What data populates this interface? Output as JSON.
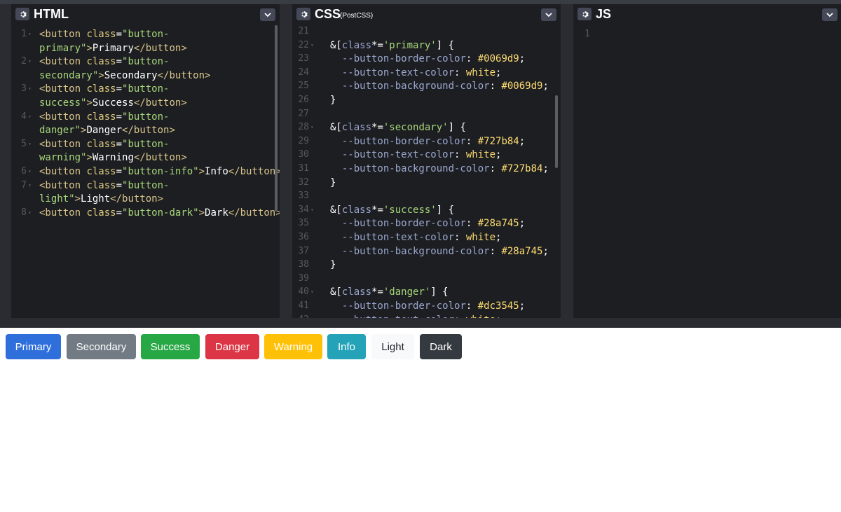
{
  "html_panel": {
    "title": "HTML",
    "gear": "gear-icon",
    "menu": "chevron-down-icon",
    "lines": [
      {
        "n": "1",
        "parts": [
          [
            "tag",
            "<button "
          ],
          [
            "attr",
            "class"
          ],
          [
            "white",
            "="
          ],
          [
            "str",
            "\"button-"
          ]
        ]
      },
      {
        "n": "",
        "parts": [
          [
            "str",
            "primary\""
          ],
          [
            "tag",
            ">"
          ],
          [
            "white",
            "Primary"
          ],
          [
            "tag",
            "</button>"
          ]
        ]
      },
      {
        "n": "2",
        "parts": [
          [
            "tag",
            "<button "
          ],
          [
            "attr",
            "class"
          ],
          [
            "white",
            "="
          ],
          [
            "str",
            "\"button-"
          ]
        ]
      },
      {
        "n": "",
        "parts": [
          [
            "str",
            "secondary\""
          ],
          [
            "tag",
            ">"
          ],
          [
            "white",
            "Secondary"
          ],
          [
            "tag",
            "</button>"
          ]
        ]
      },
      {
        "n": "3",
        "parts": [
          [
            "tag",
            "<button "
          ],
          [
            "attr",
            "class"
          ],
          [
            "white",
            "="
          ],
          [
            "str",
            "\"button-"
          ]
        ]
      },
      {
        "n": "",
        "parts": [
          [
            "str",
            "success\""
          ],
          [
            "tag",
            ">"
          ],
          [
            "white",
            "Success"
          ],
          [
            "tag",
            "</button>"
          ]
        ]
      },
      {
        "n": "4",
        "parts": [
          [
            "tag",
            "<button "
          ],
          [
            "attr",
            "class"
          ],
          [
            "white",
            "="
          ],
          [
            "str",
            "\"button-"
          ]
        ]
      },
      {
        "n": "",
        "parts": [
          [
            "str",
            "danger\""
          ],
          [
            "tag",
            ">"
          ],
          [
            "white",
            "Danger"
          ],
          [
            "tag",
            "</button>"
          ]
        ]
      },
      {
        "n": "5",
        "parts": [
          [
            "tag",
            "<button "
          ],
          [
            "attr",
            "class"
          ],
          [
            "white",
            "="
          ],
          [
            "str",
            "\"button-"
          ]
        ]
      },
      {
        "n": "",
        "parts": [
          [
            "str",
            "warning\""
          ],
          [
            "tag",
            ">"
          ],
          [
            "white",
            "Warning"
          ],
          [
            "tag",
            "</button>"
          ]
        ]
      },
      {
        "n": "6",
        "parts": [
          [
            "tag",
            "<button "
          ],
          [
            "attr",
            "class"
          ],
          [
            "white",
            "="
          ],
          [
            "str",
            "\"button-info\""
          ],
          [
            "tag",
            ">"
          ],
          [
            "white",
            "Info"
          ],
          [
            "tag",
            "</button>"
          ]
        ]
      },
      {
        "n": "7",
        "parts": [
          [
            "tag",
            "<button "
          ],
          [
            "attr",
            "class"
          ],
          [
            "white",
            "="
          ],
          [
            "str",
            "\"button-"
          ]
        ]
      },
      {
        "n": "",
        "parts": [
          [
            "str",
            "light\""
          ],
          [
            "tag",
            ">"
          ],
          [
            "white",
            "Light"
          ],
          [
            "tag",
            "</button>"
          ]
        ]
      },
      {
        "n": "8",
        "parts": [
          [
            "tag",
            "<button "
          ],
          [
            "attr",
            "class"
          ],
          [
            "white",
            "="
          ],
          [
            "str",
            "\"button-dark\""
          ],
          [
            "tag",
            ">"
          ],
          [
            "white",
            "Dark"
          ],
          [
            "tag",
            "</button>"
          ]
        ]
      }
    ]
  },
  "css_panel": {
    "title": "CSS",
    "subtitle": "(PostCSS)",
    "gear": "gear-icon",
    "menu": "chevron-down-icon",
    "lines": [
      {
        "n": "21",
        "fold": false,
        "parts": []
      },
      {
        "n": "22",
        "fold": true,
        "parts": [
          [
            "sel",
            "&["
          ],
          [
            "selattr",
            "class"
          ],
          [
            "sel",
            "*="
          ],
          [
            "str",
            "'primary'"
          ],
          [
            "sel",
            "] {"
          ]
        ]
      },
      {
        "n": "23",
        "fold": false,
        "parts": [
          [
            "white",
            "  "
          ],
          [
            "prop",
            "--button-border-color"
          ],
          [
            "white",
            ": "
          ],
          [
            "val",
            "#0069d9"
          ],
          [
            "white",
            ";"
          ]
        ]
      },
      {
        "n": "24",
        "fold": false,
        "parts": [
          [
            "white",
            "  "
          ],
          [
            "prop",
            "--button-text-color"
          ],
          [
            "white",
            ": "
          ],
          [
            "val",
            "white"
          ],
          [
            "white",
            ";"
          ]
        ]
      },
      {
        "n": "25",
        "fold": false,
        "parts": [
          [
            "white",
            "  "
          ],
          [
            "prop",
            "--button-background-color"
          ],
          [
            "white",
            ": "
          ],
          [
            "val",
            "#0069d9"
          ],
          [
            "white",
            ";"
          ]
        ]
      },
      {
        "n": "26",
        "fold": false,
        "parts": [
          [
            "white",
            "}"
          ]
        ]
      },
      {
        "n": "27",
        "fold": false,
        "parts": []
      },
      {
        "n": "28",
        "fold": true,
        "parts": [
          [
            "sel",
            "&["
          ],
          [
            "selattr",
            "class"
          ],
          [
            "sel",
            "*="
          ],
          [
            "str",
            "'secondary'"
          ],
          [
            "sel",
            "] {"
          ]
        ]
      },
      {
        "n": "29",
        "fold": false,
        "parts": [
          [
            "white",
            "  "
          ],
          [
            "prop",
            "--button-border-color"
          ],
          [
            "white",
            ": "
          ],
          [
            "val",
            "#727b84"
          ],
          [
            "white",
            ";"
          ]
        ]
      },
      {
        "n": "30",
        "fold": false,
        "parts": [
          [
            "white",
            "  "
          ],
          [
            "prop",
            "--button-text-color"
          ],
          [
            "white",
            ": "
          ],
          [
            "val",
            "white"
          ],
          [
            "white",
            ";"
          ]
        ]
      },
      {
        "n": "31",
        "fold": false,
        "parts": [
          [
            "white",
            "  "
          ],
          [
            "prop",
            "--button-background-color"
          ],
          [
            "white",
            ": "
          ],
          [
            "val",
            "#727b84"
          ],
          [
            "white",
            ";"
          ]
        ]
      },
      {
        "n": "32",
        "fold": false,
        "parts": [
          [
            "white",
            "}"
          ]
        ]
      },
      {
        "n": "33",
        "fold": false,
        "parts": []
      },
      {
        "n": "34",
        "fold": true,
        "parts": [
          [
            "sel",
            "&["
          ],
          [
            "selattr",
            "class"
          ],
          [
            "sel",
            "*="
          ],
          [
            "str",
            "'success'"
          ],
          [
            "sel",
            "] {"
          ]
        ]
      },
      {
        "n": "35",
        "fold": false,
        "parts": [
          [
            "white",
            "  "
          ],
          [
            "prop",
            "--button-border-color"
          ],
          [
            "white",
            ": "
          ],
          [
            "val",
            "#28a745"
          ],
          [
            "white",
            ";"
          ]
        ]
      },
      {
        "n": "36",
        "fold": false,
        "parts": [
          [
            "white",
            "  "
          ],
          [
            "prop",
            "--button-text-color"
          ],
          [
            "white",
            ": "
          ],
          [
            "val",
            "white"
          ],
          [
            "white",
            ";"
          ]
        ]
      },
      {
        "n": "37",
        "fold": false,
        "parts": [
          [
            "white",
            "  "
          ],
          [
            "prop",
            "--button-background-color"
          ],
          [
            "white",
            ": "
          ],
          [
            "val",
            "#28a745"
          ],
          [
            "white",
            ";"
          ]
        ]
      },
      {
        "n": "38",
        "fold": false,
        "parts": [
          [
            "white",
            "}"
          ]
        ]
      },
      {
        "n": "39",
        "fold": false,
        "parts": []
      },
      {
        "n": "40",
        "fold": true,
        "parts": [
          [
            "sel",
            "&["
          ],
          [
            "selattr",
            "class"
          ],
          [
            "sel",
            "*="
          ],
          [
            "str",
            "'danger'"
          ],
          [
            "sel",
            "] {"
          ]
        ]
      },
      {
        "n": "41",
        "fold": false,
        "parts": [
          [
            "white",
            "  "
          ],
          [
            "prop",
            "--button-border-color"
          ],
          [
            "white",
            ": "
          ],
          [
            "val",
            "#dc3545"
          ],
          [
            "white",
            ";"
          ]
        ]
      },
      {
        "n": "42",
        "fold": false,
        "parts": [
          [
            "white",
            "  "
          ],
          [
            "prop",
            "--button-text-color"
          ],
          [
            "white",
            ": "
          ],
          [
            "val",
            "white"
          ],
          [
            "white",
            ";"
          ]
        ]
      }
    ]
  },
  "js_panel": {
    "title": "JS",
    "gear": "gear-icon",
    "menu": "chevron-down-icon",
    "lines": [
      {
        "n": "1"
      }
    ]
  },
  "preview": {
    "buttons": [
      {
        "label": "Primary",
        "bg": "#2f6fdc",
        "fg": "#ffffff",
        "border": "#2f6fdc"
      },
      {
        "label": "Secondary",
        "bg": "#727b84",
        "fg": "#ffffff",
        "border": "#727b84"
      },
      {
        "label": "Success",
        "bg": "#28a745",
        "fg": "#ffffff",
        "border": "#28a745"
      },
      {
        "label": "Danger",
        "bg": "#dc3545",
        "fg": "#ffffff",
        "border": "#dc3545"
      },
      {
        "label": "Warning",
        "bg": "#ffc107",
        "fg": "#ffffff",
        "border": "#ffc107"
      },
      {
        "label": "Info",
        "bg": "#23a2b8",
        "fg": "#ffffff",
        "border": "#23a2b8"
      },
      {
        "label": "Light",
        "bg": "#f8f9fa",
        "fg": "#212529",
        "border": "#f8f9fa"
      },
      {
        "label": "Dark",
        "bg": "#343a40",
        "fg": "#ffffff",
        "border": "#343a40"
      }
    ]
  }
}
